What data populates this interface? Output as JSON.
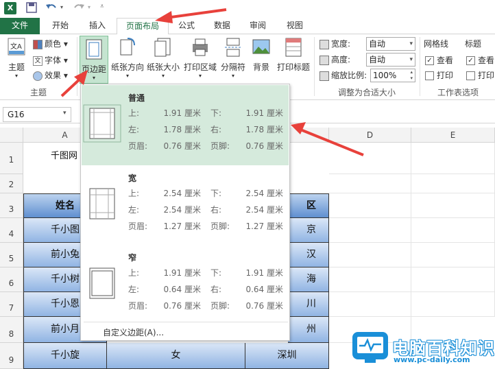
{
  "qat": {
    "app_icon_label": "X",
    "icons": [
      "save-icon",
      "undo-icon",
      "redo-icon",
      "customize-icon"
    ]
  },
  "tabs": [
    "文件",
    "开始",
    "插入",
    "页面布局",
    "公式",
    "数据",
    "审阅",
    "视图"
  ],
  "ribbon": {
    "theme_group": {
      "label": "主题",
      "themes_btn": "主题",
      "colors": "颜色",
      "fonts": "字体",
      "effects": "效果"
    },
    "page_setup": {
      "margins": "页边距",
      "orientation": "纸张方向",
      "size": "纸张大小",
      "print_area": "打印区域",
      "breaks": "分隔符",
      "background": "背景",
      "print_titles": "打印标题"
    },
    "scale_group": {
      "label": "调整为合适大小",
      "width_label": "宽度:",
      "width_value": "自动",
      "height_label": "高度:",
      "height_value": "自动",
      "scale_label": "缩放比例:",
      "scale_value": "100%"
    },
    "sheet_options": {
      "label": "工作表选项",
      "gridlines": "网格线",
      "headings": "标题",
      "view": "查看",
      "print": "打印",
      "view2": "查看",
      "print2": "打印"
    }
  },
  "namebox": "G16",
  "columns": [
    "A",
    "D",
    "E"
  ],
  "rows": [
    "1",
    "2",
    "3",
    "4",
    "5",
    "6",
    "7",
    "8",
    "9"
  ],
  "sheet": {
    "a1": "千图网",
    "header_a": "姓名",
    "header_c": "区",
    "names": [
      "千小图",
      "前小兔",
      "千小树",
      "千小恩",
      "前小月",
      "千小旋"
    ],
    "regions": [
      "京",
      "汉",
      "海",
      "川",
      "州",
      "深圳"
    ],
    "row9_b": "女"
  },
  "margins_menu": {
    "options": [
      {
        "name": "普通",
        "top": "1.91 厘米",
        "bottom": "1.91 厘米",
        "left": "1.78 厘米",
        "right": "1.78 厘米",
        "header": "0.76 厘米",
        "footer": "0.76 厘米"
      },
      {
        "name": "宽",
        "top": "2.54 厘米",
        "bottom": "2.54 厘米",
        "left": "2.54 厘米",
        "right": "2.54 厘米",
        "header": "1.27 厘米",
        "footer": "1.27 厘米"
      },
      {
        "name": "窄",
        "top": "1.91 厘米",
        "bottom": "1.91 厘米",
        "left": "0.64 厘米",
        "right": "0.64 厘米",
        "header": "0.76 厘米",
        "footer": "0.76 厘米"
      }
    ],
    "labels": {
      "top": "上:",
      "bottom": "下:",
      "left": "左:",
      "right": "右:",
      "header": "页眉:",
      "footer": "页脚:"
    },
    "custom": "自定义边距(A)..."
  },
  "watermark": {
    "title": "电脑百科知识",
    "url": "www.pc-daily.com"
  },
  "colors": {
    "excel_green": "#217346",
    "selected": "#d5eadc",
    "arrow": "#e8413b",
    "logo_blue": "#1a8fd8"
  }
}
